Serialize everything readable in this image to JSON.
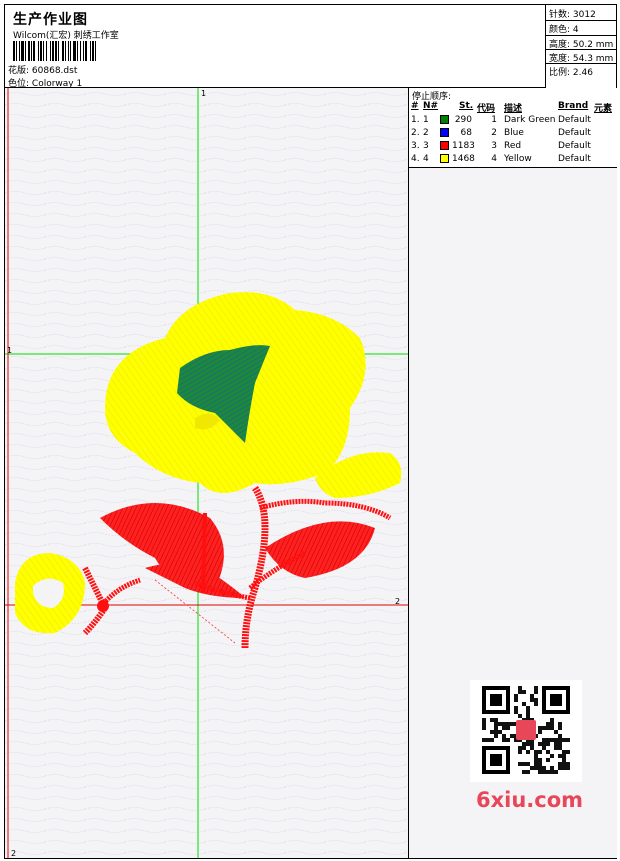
{
  "header": {
    "title": "生产作业图",
    "subtitle": "Wilcom(汇宏) 刺绣工作室",
    "design_file_label": "花版:",
    "design_file": "60868.dst",
    "colorway_label": "色位:",
    "colorway": "Colorway 1"
  },
  "stats": {
    "stitches": "针数: 3012",
    "colors": "颜色: 4",
    "height": "高度: 50.2 mm",
    "width": "宽度: 54.3 mm",
    "scale": "比例: 2.46"
  },
  "stop_sequence": {
    "title": "停止顺序:",
    "headers": [
      "#",
      "N#",
      "St.",
      "代码",
      "描述",
      "Brand",
      "元素"
    ],
    "rows": [
      {
        "idx": "1.",
        "n": "1",
        "color": "#008000",
        "st": "290",
        "code": "1",
        "desc": "Dark Green",
        "brand": "Default"
      },
      {
        "idx": "2.",
        "n": "2",
        "color": "#0000ff",
        "st": "68",
        "code": "2",
        "desc": "Blue",
        "brand": "Default"
      },
      {
        "idx": "3.",
        "n": "3",
        "color": "#ff0000",
        "st": "1183",
        "code": "3",
        "desc": "Red",
        "brand": "Default"
      },
      {
        "idx": "4.",
        "n": "4",
        "color": "#ffff00",
        "st": "1468",
        "code": "4",
        "desc": "Yellow",
        "brand": "Default"
      }
    ]
  },
  "guides": {
    "v1_label": "1",
    "h1_label": "1",
    "h2_label": "2",
    "v2_label": "2"
  },
  "watermark": {
    "text": "6xiu.com"
  },
  "colors": {
    "guide_green": "#00dd00",
    "guide_red": "#e00000",
    "yellow": "#ffff00",
    "red": "#ff0000",
    "green": "#008000",
    "blue": "#0000ff"
  }
}
